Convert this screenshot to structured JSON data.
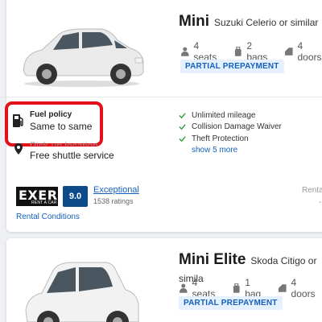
{
  "cars": [
    {
      "class_name": "Mini",
      "similar_text": "Suzuki Celerio or similar",
      "seats": "4 seats",
      "bags": "2 bags",
      "doors": "4 doors",
      "badge": "PARTIAL PREPAYMENT",
      "fuel_policy_title": "Fuel policy",
      "fuel_policy_value": "Same to same",
      "pickup_partial": "Pick-up location",
      "shuttle": "Free shuttle service",
      "features": [
        "Unlimited mileage",
        "Collision Damage Waiver",
        "Theft Protection"
      ],
      "show_more": "show 5 more",
      "supplier_logo_big": "EXER",
      "supplier_logo_small": "RENT A CAR",
      "score": "9.0",
      "rating_word": "Exceptional",
      "rating_count": "1538 ratings",
      "conditions_link": "Rental Conditions",
      "right_partial": "Renta",
      "right_partial2": "-"
    },
    {
      "class_name": "Mini Elite",
      "similar_text": "Skoda Citigo or simila",
      "seats": "4 seats",
      "bags": "1 bag",
      "doors": "4 doors",
      "badge": "PARTIAL PREPAYMENT"
    }
  ],
  "colors": {
    "link": "#1560bd",
    "badge_bg": "#e5f1ff",
    "score_bg": "#0d4a8a",
    "highlight": "#e3101b",
    "check": "#2e9e3e"
  },
  "icons": [
    "car-image",
    "seat-icon",
    "bag-icon",
    "door-icon",
    "fuel-pump-icon",
    "location-pin-icon",
    "check-icon"
  ]
}
